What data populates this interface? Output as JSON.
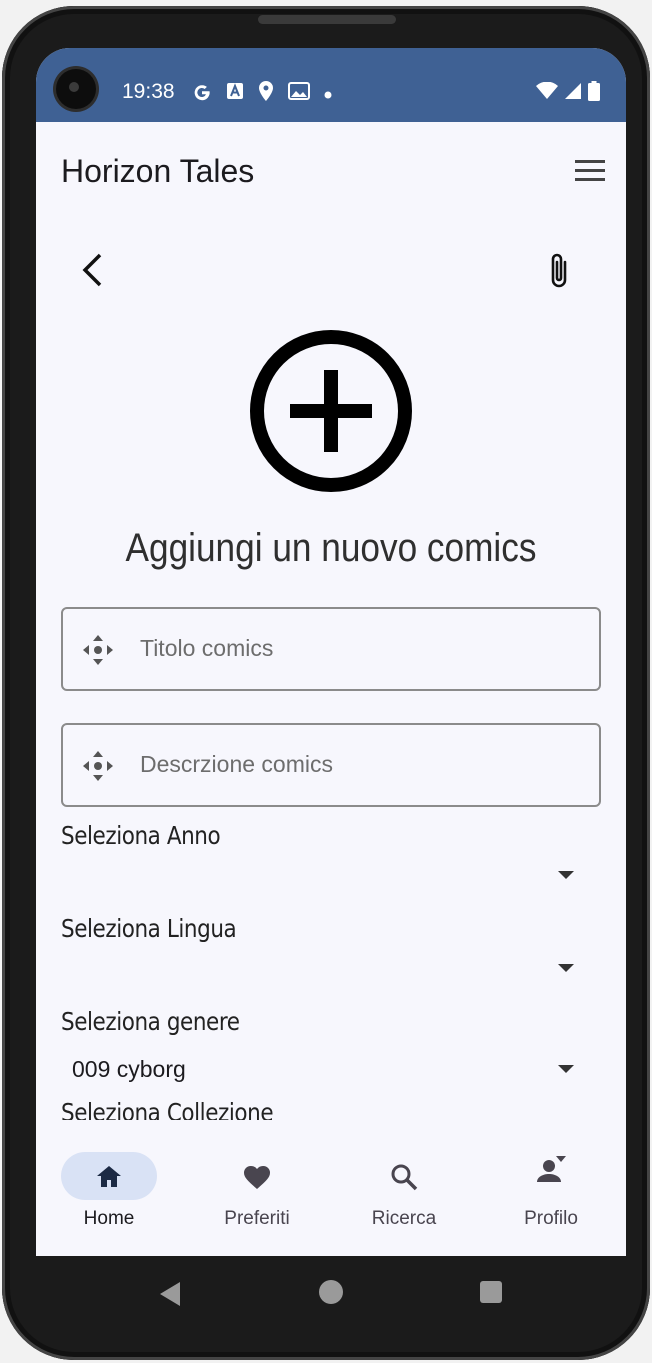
{
  "status_bar": {
    "time": "19:38",
    "left_icons": [
      "google-icon",
      "translate-icon",
      "location-icon",
      "gallery-icon",
      "dot-icon"
    ],
    "right_icons": [
      "wifi-icon",
      "signal-icon",
      "battery-icon"
    ]
  },
  "app_bar": {
    "title": "Horizon Tales"
  },
  "page": {
    "heading": "Aggiungi un nuovo comics"
  },
  "form": {
    "title_placeholder": "Titolo comics",
    "description_placeholder": "Descrzione comics",
    "year": {
      "label": "Seleziona Anno",
      "value": ""
    },
    "language": {
      "label": "Seleziona Lingua",
      "value": ""
    },
    "genre": {
      "label": "Seleziona genere",
      "value": "009 cyborg"
    },
    "collection": {
      "label": "Seleziona Collezione"
    }
  },
  "bottom_nav": {
    "items": [
      {
        "label": "Home",
        "icon": "home-icon",
        "active": true
      },
      {
        "label": "Preferiti",
        "icon": "heart-icon",
        "active": false
      },
      {
        "label": "Ricerca",
        "icon": "search-icon",
        "active": false
      },
      {
        "label": "Profilo",
        "icon": "profile-icon",
        "active": false
      }
    ]
  },
  "colors": {
    "status_bar": "#3f6194",
    "background": "#f7f7fd",
    "active_pill": "#d9e2f5"
  }
}
